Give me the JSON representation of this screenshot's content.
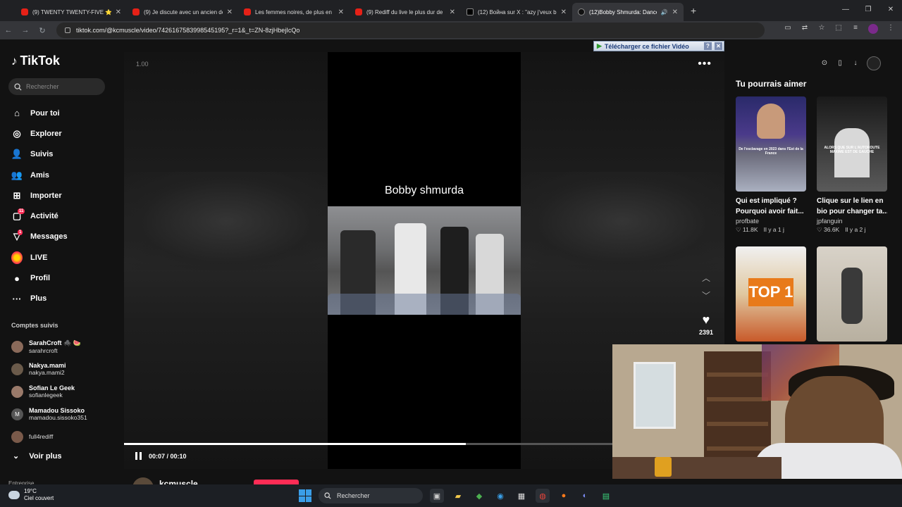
{
  "browser": {
    "tabs": [
      {
        "title": "(9) TWENTY TWENTY-FIVE ⭐",
        "type": "yt"
      },
      {
        "title": "(9) Je discute avec un ancien de",
        "type": "yt"
      },
      {
        "title": "Les femmes noires, de plus en",
        "type": "yt"
      },
      {
        "title": "(9) Rediff du live le plus dur de",
        "type": "yt"
      },
      {
        "title": "(12) Война sur X : \"azy j'veux b",
        "type": "x"
      },
      {
        "title": "(12)Bobby Shmurda: Dance",
        "type": "tt",
        "active": true
      }
    ],
    "new_tab": "+",
    "url": "tiktok.com/@kcmuscle/video/7426167583998545195?_r=1&_t=ZN-8zjHbejIcQo"
  },
  "download_banner": {
    "label": "Télécharger ce fichier Vidéo",
    "help": "?",
    "close": "✕"
  },
  "sidebar": {
    "brand": "TikTok",
    "search_placeholder": "Rechercher",
    "nav": [
      {
        "label": "Pour toi",
        "icon": "home-icon"
      },
      {
        "label": "Explorer",
        "icon": "compass-icon"
      },
      {
        "label": "Suivis",
        "icon": "following-icon"
      },
      {
        "label": "Amis",
        "icon": "friends-icon"
      },
      {
        "label": "Importer",
        "icon": "upload-icon"
      },
      {
        "label": "Activité",
        "icon": "activity-icon",
        "badge": "11"
      },
      {
        "label": "Messages",
        "icon": "messages-icon",
        "badge": "1"
      },
      {
        "label": "LIVE",
        "icon": "live-icon"
      },
      {
        "label": "Profil",
        "icon": "profile-icon"
      },
      {
        "label": "Plus",
        "icon": "more-icon"
      }
    ],
    "followed_title": "Comptes suivis",
    "followed": [
      {
        "name": "SarahCroft 🕷️ 🍉",
        "handle": "sarahrcroft",
        "initial": ""
      },
      {
        "name": "Nakya.mami",
        "handle": "nakya.mami2",
        "initial": ""
      },
      {
        "name": "Sofian Le Geek",
        "handle": "sofianlegeek",
        "initial": ""
      },
      {
        "name": "Mamadou Sissoko",
        "handle": "mamadou.sissoko351",
        "initial": "M"
      },
      {
        "name": "",
        "handle": "full4rediff",
        "initial": ""
      }
    ],
    "see_more": "Voir plus",
    "entreprise": "Entreprise"
  },
  "video": {
    "speed": "1.00",
    "caption": "Bobby shmurda",
    "likes": "2391",
    "time": "00:07 / 00:10",
    "progress": 0.7,
    "author": "kcmuscle"
  },
  "right_panel": {
    "title": "Tu pourrais aimer",
    "cards": [
      {
        "title": "Qui est impliqué ?",
        "subtitle": "Pourquoi avoir fait...",
        "author": "profbate",
        "likes": "11.8K",
        "age": "Il y a 1 j",
        "thumb_text": "De l'esclavage en 2023 dans l'Est de la France"
      },
      {
        "title": "Clique sur le lien en",
        "subtitle": "bio pour changer ta...",
        "author": "jpfanguin",
        "likes": "36.6K",
        "age": "Il y a 2 j",
        "thumb_text": "ALORS QUE SUR L'AUTOROUTE MAXIME EST DE GAUCHE"
      },
      {
        "title": "",
        "subtitle": "",
        "author": "",
        "likes": "",
        "age": "",
        "thumb_text": "TOP 1"
      },
      {
        "title": "",
        "subtitle": "",
        "author": "",
        "likes": "",
        "age": "",
        "thumb_text": ""
      }
    ]
  },
  "taskbar": {
    "temperature": "19°C",
    "weather": "Ciel couvert",
    "search": "Rechercher"
  }
}
